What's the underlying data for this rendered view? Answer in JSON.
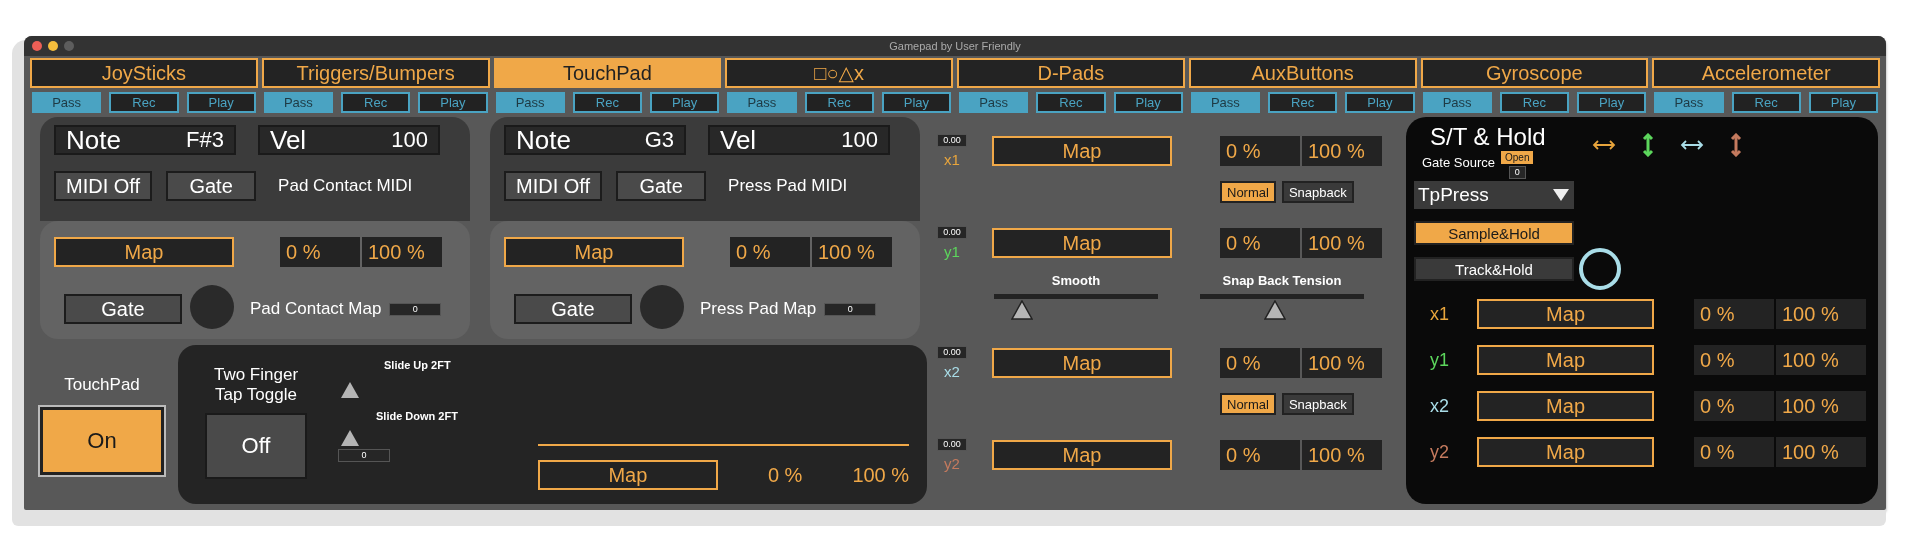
{
  "window": {
    "title": "Gamepad by User Friendly"
  },
  "tabs": [
    {
      "label": "JoySticks",
      "selected": false,
      "modes": [
        {
          "label": "Pass",
          "selected": true
        },
        {
          "label": "Rec",
          "selected": false
        },
        {
          "label": "Play",
          "selected": false
        }
      ]
    },
    {
      "label": "Triggers/Bumpers",
      "selected": false,
      "modes": [
        {
          "label": "Pass",
          "selected": true
        },
        {
          "label": "Rec",
          "selected": false
        },
        {
          "label": "Play",
          "selected": false
        }
      ]
    },
    {
      "label": "TouchPad",
      "selected": true,
      "modes": [
        {
          "label": "Pass",
          "selected": true
        },
        {
          "label": "Rec",
          "selected": false
        },
        {
          "label": "Play",
          "selected": false
        }
      ]
    },
    {
      "label": "□○△x",
      "selected": false,
      "modes": [
        {
          "label": "Pass",
          "selected": true
        },
        {
          "label": "Rec",
          "selected": false
        },
        {
          "label": "Play",
          "selected": false
        }
      ]
    },
    {
      "label": "D-Pads",
      "selected": false,
      "modes": [
        {
          "label": "Pass",
          "selected": true
        },
        {
          "label": "Rec",
          "selected": false
        },
        {
          "label": "Play",
          "selected": false
        }
      ]
    },
    {
      "label": "AuxButtons",
      "selected": false,
      "modes": [
        {
          "label": "Pass",
          "selected": true
        },
        {
          "label": "Rec",
          "selected": false
        },
        {
          "label": "Play",
          "selected": false
        }
      ]
    },
    {
      "label": "Gyroscope",
      "selected": false,
      "modes": [
        {
          "label": "Pass",
          "selected": true
        },
        {
          "label": "Rec",
          "selected": false
        },
        {
          "label": "Play",
          "selected": false
        }
      ]
    },
    {
      "label": "Accelerometer",
      "selected": false,
      "modes": [
        {
          "label": "Pass",
          "selected": true
        },
        {
          "label": "Rec",
          "selected": false
        },
        {
          "label": "Play",
          "selected": false
        }
      ]
    }
  ],
  "pads": [
    {
      "note_label": "Note",
      "note": "F#3",
      "vel_label": "Vel",
      "vel": "100",
      "midi_button": "MIDI Off",
      "midi_gate": "Gate",
      "midi_title": "Pad Contact MIDI",
      "map_button": "Map",
      "min": "0 %",
      "max": "100 %",
      "map_gate": "Gate",
      "map_title": "Pad Contact Map",
      "value": "0"
    },
    {
      "note_label": "Note",
      "note": "G3",
      "vel_label": "Vel",
      "vel": "100",
      "midi_button": "MIDI Off",
      "midi_gate": "Gate",
      "midi_title": "Press Pad MIDI",
      "map_button": "Map",
      "min": "0 %",
      "max": "100 %",
      "map_gate": "Gate",
      "map_title": "Press Pad Map",
      "value": "0"
    }
  ],
  "touchpad": {
    "label": "TouchPad",
    "button": "On",
    "on": true
  },
  "two_finger": {
    "label": "Two Finger Tap Toggle",
    "button": "Off",
    "on": false,
    "slide_up": "Slide Up 2FT",
    "slide_down": "Slide Down 2FT",
    "value": "0",
    "map_button": "Map",
    "min": "0 %",
    "max": "100 %"
  },
  "axes": [
    {
      "value": "0.00",
      "label": "x1",
      "color": "#e8a53c",
      "map_button": "Map",
      "min": "0 %",
      "max": "100 %"
    },
    {
      "value": "0.00",
      "label": "y1",
      "color": "#5cd65c",
      "map_button": "Map",
      "min": "0 %",
      "max": "100 %"
    },
    {
      "value": "0.00",
      "label": "x2",
      "color": "#a9dde8",
      "map_button": "Map",
      "min": "0 %",
      "max": "100 %"
    },
    {
      "value": "0.00",
      "label": "y2",
      "color": "#c47a5e",
      "map_button": "Map",
      "min": "0 %",
      "max": "100 %"
    }
  ],
  "snap_toggles": [
    {
      "options": [
        {
          "label": "Normal",
          "selected": true
        },
        {
          "label": "Snapback",
          "selected": false
        }
      ]
    },
    {
      "options": [
        {
          "label": "Normal",
          "selected": true
        },
        {
          "label": "Snapback",
          "selected": false
        }
      ]
    }
  ],
  "sliders": [
    {
      "label": "Smooth",
      "level": 0.17
    },
    {
      "label": "Snap Back Tension",
      "level": 0.46
    }
  ],
  "hold": {
    "title": "S/T & Hold",
    "arrows": [
      {
        "kind": "horizontal",
        "color": "#e8a53c"
      },
      {
        "kind": "vertical",
        "color": "#5cd65c"
      },
      {
        "kind": "horizontal",
        "color": "#a9dde8"
      },
      {
        "kind": "vertical",
        "color": "#c47a5e"
      }
    ],
    "gate_source": "Gate Source",
    "gate_state": "Open",
    "gate_value": "0",
    "source": "TpPress",
    "modes": [
      {
        "label": "Sample&Hold",
        "selected": true
      },
      {
        "label": "Track&Hold",
        "selected": false
      }
    ],
    "rows": [
      {
        "label": "x1",
        "color": "#e8a53c",
        "map_button": "Map",
        "min": "0 %",
        "max": "100 %"
      },
      {
        "label": "y1",
        "color": "#5cd65c",
        "map_button": "Map",
        "min": "0 %",
        "max": "100 %"
      },
      {
        "label": "x2",
        "color": "#a9dde8",
        "map_button": "Map",
        "min": "0 %",
        "max": "100 %"
      },
      {
        "label": "y2",
        "color": "#c47a5e",
        "map_button": "Map",
        "min": "0 %",
        "max": "100 %"
      }
    ]
  }
}
